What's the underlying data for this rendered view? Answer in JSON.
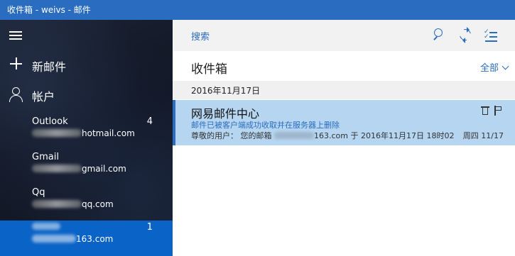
{
  "window": {
    "title": "收件箱 - weivs - 邮件"
  },
  "sidebar": {
    "new_mail_label": "新邮件",
    "accounts_label": "帐户",
    "accounts": [
      {
        "name": "Outlook",
        "address_suffix": "hotmail.com",
        "count": "4"
      },
      {
        "name": "Gmail",
        "address_suffix": "gmail.com",
        "count": ""
      },
      {
        "name": "Qq",
        "address_suffix": "qq.com",
        "count": ""
      },
      {
        "name": "",
        "address_suffix": "163.com",
        "count": "1"
      }
    ]
  },
  "toolbar": {
    "search_label": "搜索"
  },
  "folder": {
    "title": "收件箱",
    "filter_label": "全部"
  },
  "messages": {
    "group_date": "2016年11月17日",
    "items": [
      {
        "sender": "网易邮件中心",
        "subject": "邮件已被客户端成功收取并在服务器上删除",
        "preview_prefix": "尊敬的用户：  您的邮箱",
        "preview_suffix": "163.com 于 2016年11月17日 18时02",
        "date": "周四 11/17"
      }
    ]
  },
  "colors": {
    "accent": "#2a6cc0",
    "selected_account": "#0a63c6",
    "selected_message": "#b5d5f0"
  }
}
